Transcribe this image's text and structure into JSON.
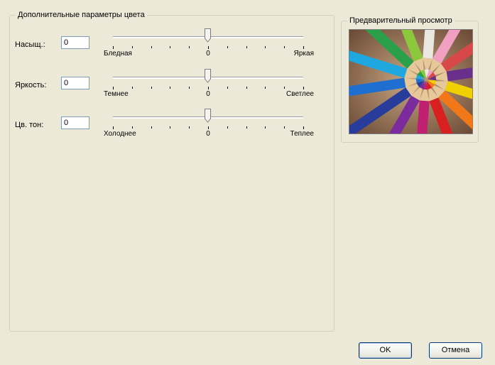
{
  "color_group": {
    "title": "Дополнительные параметры цвета",
    "rows": [
      {
        "label": "Насыщ.:",
        "value": "0",
        "min_label": "Бледная",
        "mid_label": "0",
        "max_label": "Яркая",
        "position_percent": 50
      },
      {
        "label": "Яркость:",
        "value": "0",
        "min_label": "Темнее",
        "mid_label": "0",
        "max_label": "Светлее",
        "position_percent": 50
      },
      {
        "label": "Цв. тон:",
        "value": "0",
        "min_label": "Холоднее",
        "mid_label": "0",
        "max_label": "Теплее",
        "position_percent": 50
      }
    ]
  },
  "preview_group": {
    "title": "Предварительный просмотр",
    "image_icon": "colored-pencils-image"
  },
  "buttons": {
    "ok_label": "OK",
    "cancel_label": "Отмена"
  },
  "colors": {
    "dialog_background": "#ece9d8",
    "input_border": "#7f9db9",
    "button_border": "#003c74"
  }
}
